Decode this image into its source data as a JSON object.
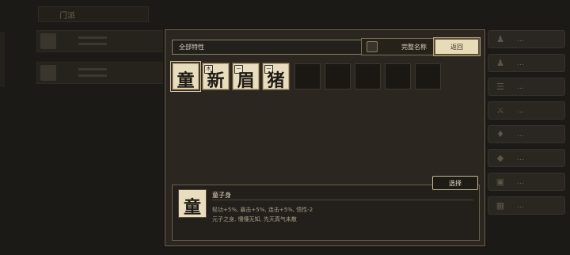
{
  "background": {
    "title_tab": "门派",
    "rows": [
      {
        "name": "…",
        "n1": "…",
        "n2": "…"
      },
      {
        "name": "…",
        "n1": "…",
        "n2": "…"
      }
    ]
  },
  "right_menu": [
    {
      "label": "…",
      "icon": "person-icon"
    },
    {
      "label": "…",
      "icon": "people-icon"
    },
    {
      "label": "…",
      "icon": "scroll-icon"
    },
    {
      "label": "…",
      "icon": "sword-icon"
    },
    {
      "label": "…",
      "icon": "tag-icon"
    },
    {
      "label": "…",
      "icon": "diamond-icon"
    },
    {
      "label": "…",
      "icon": "cart-icon"
    },
    {
      "label": "…",
      "icon": "door-icon"
    }
  ],
  "modal": {
    "filter_label": "全部特性",
    "checkbox_label": "完整名称",
    "return_label": "返回",
    "select_label": "选择",
    "traits": [
      {
        "glyph": "童",
        "badge": "",
        "selected": true
      },
      {
        "glyph": "新",
        "badge": "木",
        "selected": false
      },
      {
        "glyph": "眉",
        "badge": "一",
        "selected": false
      },
      {
        "glyph": "猪",
        "badge": "一",
        "selected": false
      }
    ],
    "empty_slots": 5,
    "detail": {
      "glyph": "童",
      "badge": "",
      "name": "童子身",
      "line1": "轻功+5%, 暴击+5%, 连击+5%, 悟性-2",
      "line2": "元子之身, 懵懂无知, 先天真气未散"
    }
  }
}
